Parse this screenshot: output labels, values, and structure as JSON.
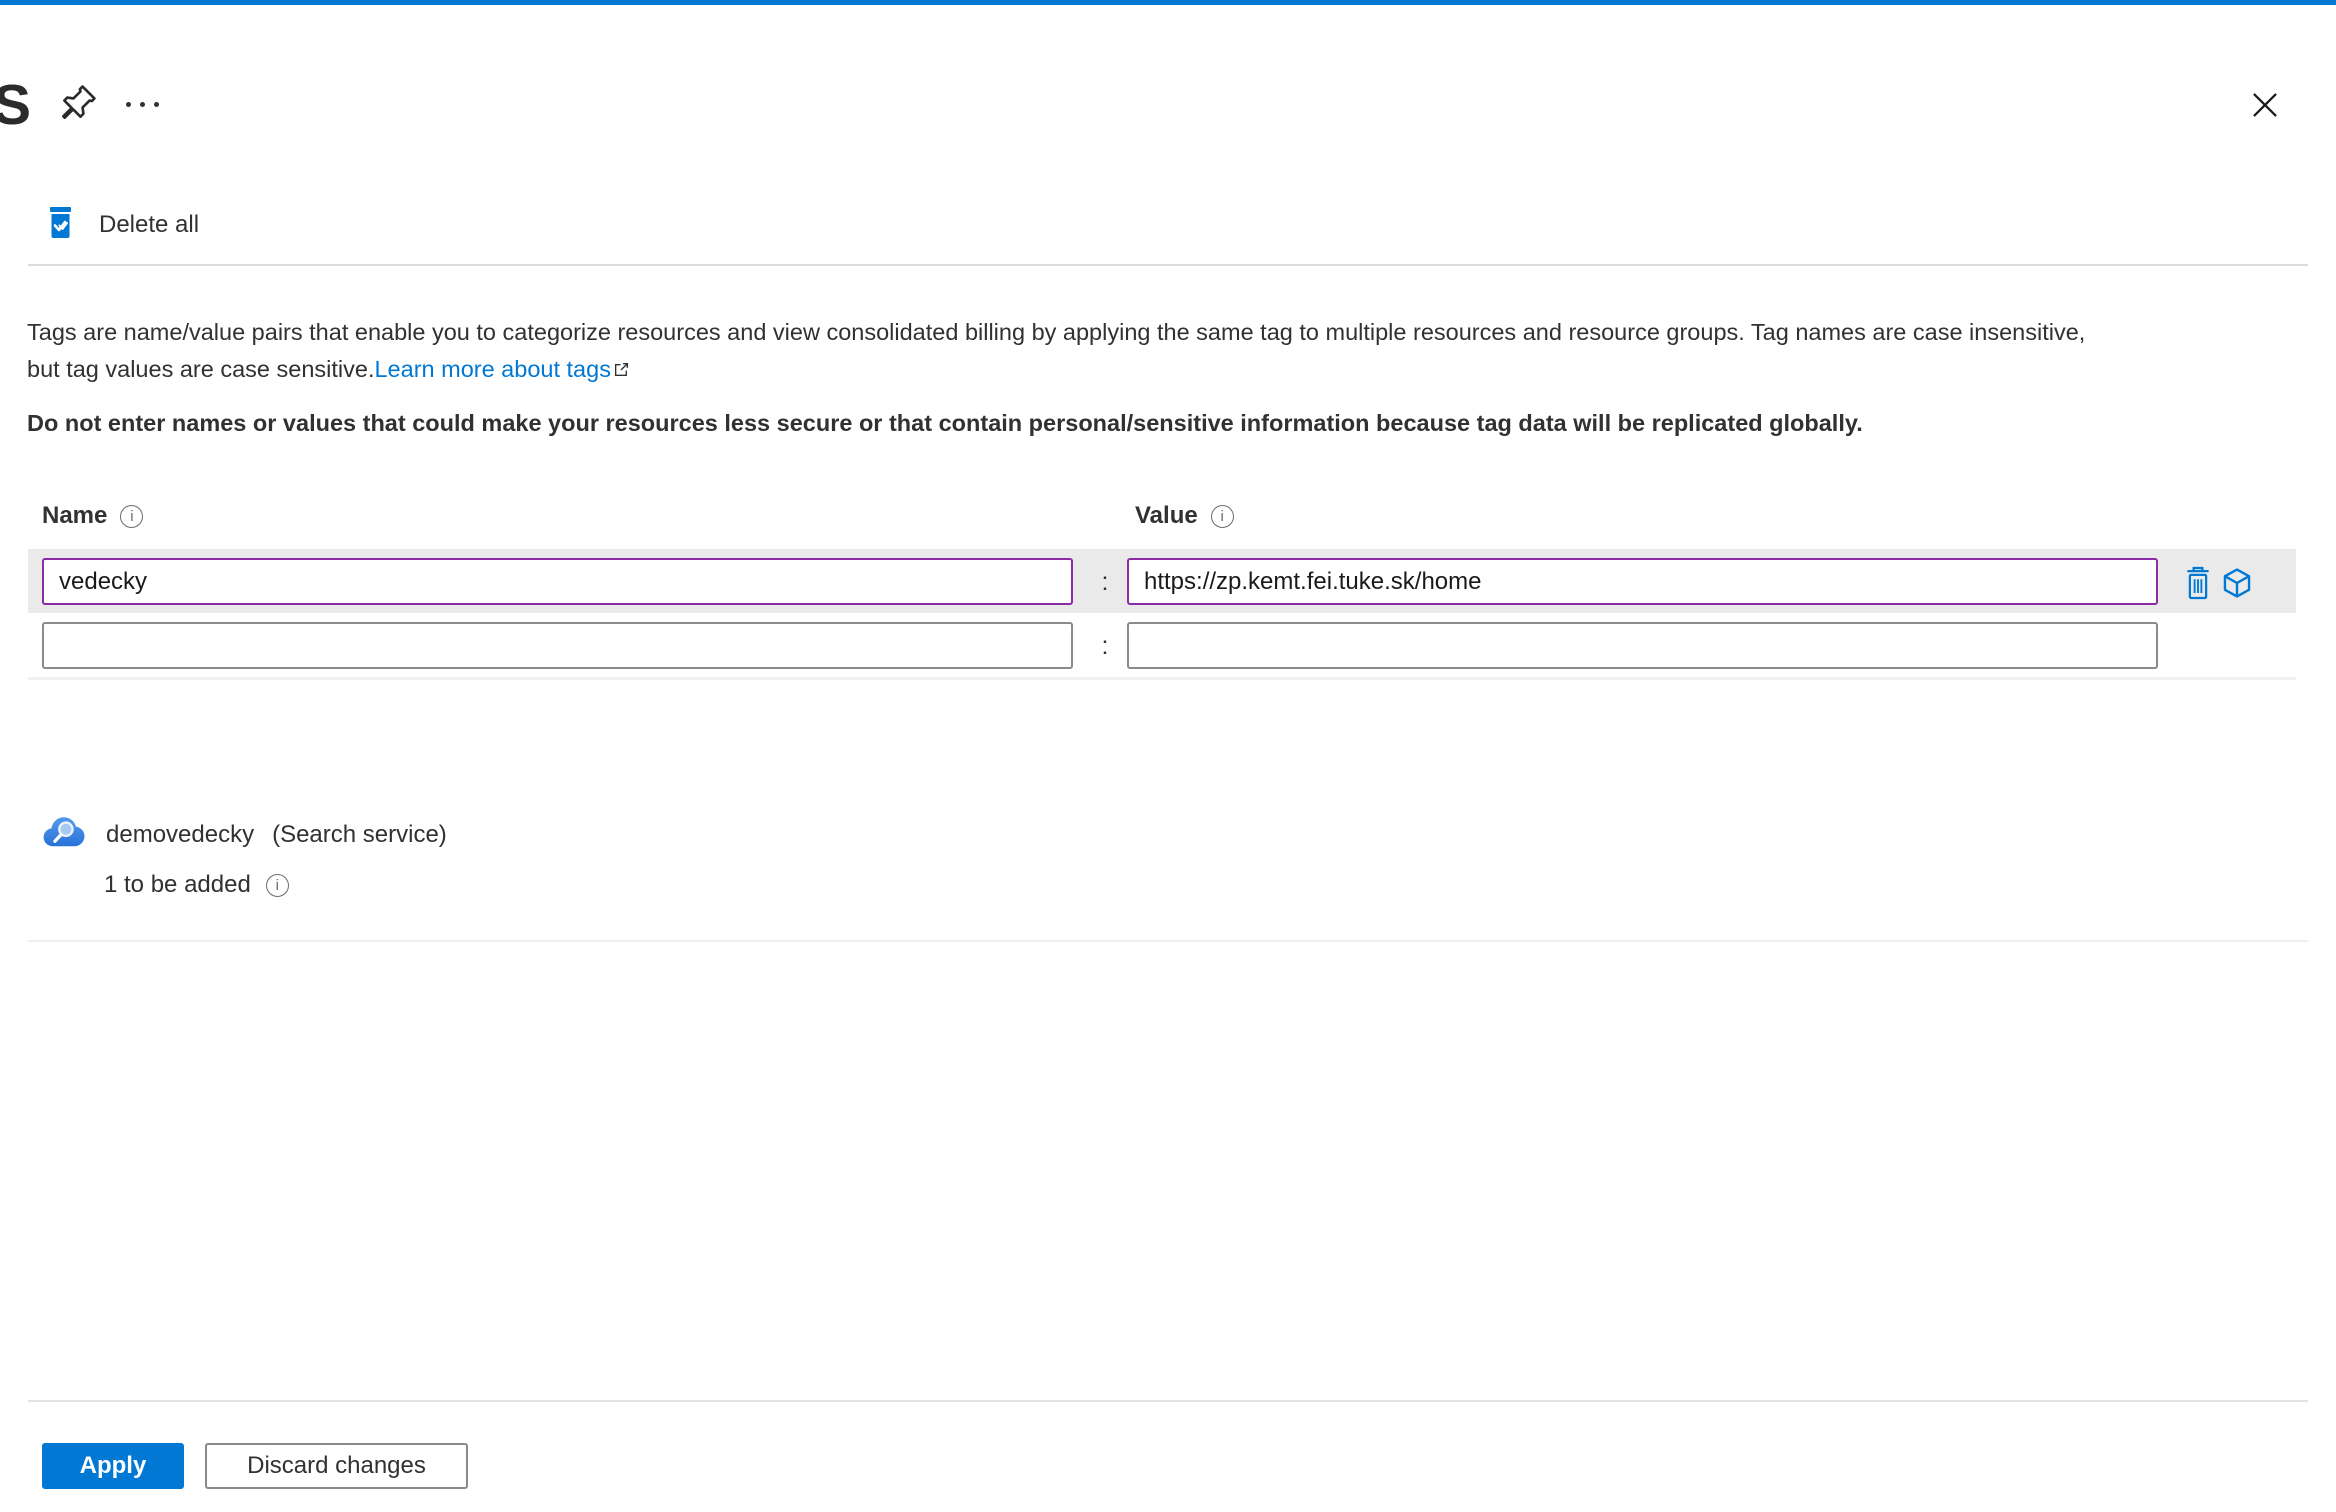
{
  "header": {
    "partial_title": "S"
  },
  "command_bar": {
    "delete_all_label": "Delete all"
  },
  "description": {
    "line1": "Tags are name/value pairs that enable you to categorize resources and view consolidated billing by applying the same tag to multiple resources and resource groups. Tag names are case insensitive,",
    "line2": "but tag values are case sensitive.",
    "learn_more_label": "Learn more about tags"
  },
  "warning": "Do not enter names or values that could make your resources less secure or that contain personal/sensitive information because tag data will be replicated globally.",
  "tag_editor": {
    "name_header": "Name",
    "value_header": "Value",
    "separator": ":",
    "rows": [
      {
        "name": "vedecky",
        "value": "https://zp.kemt.fei.tuke.sk/home",
        "modified": true
      },
      {
        "name": "",
        "value": "",
        "modified": false
      }
    ]
  },
  "resource": {
    "name": "demovedecky",
    "type": "(Search service)",
    "status": "1 to be added"
  },
  "footer": {
    "apply_label": "Apply",
    "discard_label": "Discard changes"
  },
  "colors": {
    "accent": "#0078d4",
    "modified_border": "#8a2da5",
    "row_highlight": "#eaeaea",
    "icon_blue": "#0078d4",
    "link": "#0078d4"
  },
  "icons": {
    "pin": "pin-icon",
    "more": "ellipsis-icon",
    "close": "close-icon",
    "delete_all": "trash-check-icon",
    "info": "info-icon",
    "external_link": "external-link-icon",
    "row_delete": "trash-icon",
    "row_resource": "cube-icon",
    "search_service": "search-service-cloud-icon"
  }
}
